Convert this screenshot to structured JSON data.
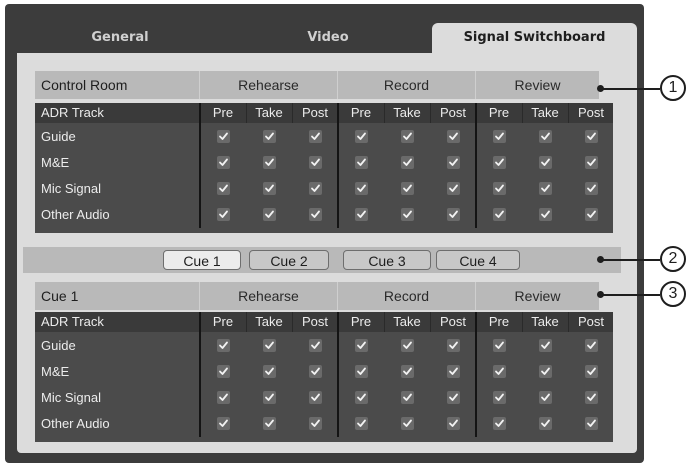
{
  "tabs": [
    {
      "label": "General",
      "active": false
    },
    {
      "label": "Video",
      "active": false
    },
    {
      "label": "Signal Switchboard",
      "active": true
    }
  ],
  "sections": [
    {
      "title": "Control Room",
      "groups": [
        "Rehearse",
        "Record",
        "Review"
      ],
      "track_header": "ADR Track",
      "columns": [
        "Pre",
        "Take",
        "Post"
      ],
      "rows": [
        {
          "label": "Guide",
          "checked": [
            true,
            true,
            true,
            true,
            true,
            true,
            true,
            true,
            true
          ]
        },
        {
          "label": "M&E",
          "checked": [
            true,
            true,
            true,
            true,
            true,
            true,
            true,
            true,
            true
          ]
        },
        {
          "label": "Mic Signal",
          "checked": [
            true,
            true,
            true,
            true,
            true,
            true,
            true,
            true,
            true
          ]
        },
        {
          "label": "Other Audio",
          "checked": [
            true,
            true,
            true,
            true,
            true,
            true,
            true,
            true,
            true
          ]
        }
      ]
    },
    {
      "title": "Cue 1",
      "groups": [
        "Rehearse",
        "Record",
        "Review"
      ],
      "track_header": "ADR Track",
      "columns": [
        "Pre",
        "Take",
        "Post"
      ],
      "rows": [
        {
          "label": "Guide",
          "checked": [
            true,
            true,
            true,
            true,
            true,
            true,
            true,
            true,
            true
          ]
        },
        {
          "label": "M&E",
          "checked": [
            true,
            true,
            true,
            true,
            true,
            true,
            true,
            true,
            true
          ]
        },
        {
          "label": "Mic Signal",
          "checked": [
            true,
            true,
            true,
            true,
            true,
            true,
            true,
            true,
            true
          ]
        },
        {
          "label": "Other Audio",
          "checked": [
            true,
            true,
            true,
            true,
            true,
            true,
            true,
            true,
            true
          ]
        }
      ]
    }
  ],
  "cue_buttons": [
    {
      "label": "Cue 1",
      "active": true
    },
    {
      "label": "Cue 2",
      "active": false
    },
    {
      "label": "Cue 3",
      "active": false
    },
    {
      "label": "Cue 4",
      "active": false
    }
  ],
  "callouts": [
    "1",
    "2",
    "3"
  ],
  "icons": {
    "checkbox": "checkmark-icon"
  }
}
